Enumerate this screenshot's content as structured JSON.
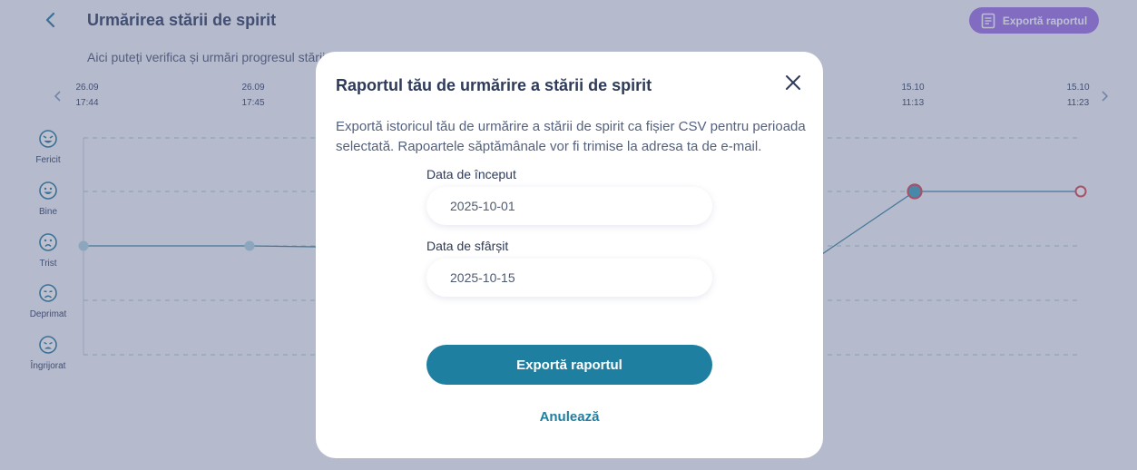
{
  "header": {
    "title": "Urmărirea stării de spirit",
    "subtitle": "Aici puteți verifica și urmări progresul stării de spirit",
    "export_label": "Exportă raportul"
  },
  "timeline": {
    "labels": [
      {
        "date": "26.09",
        "time": "17:44"
      },
      {
        "date": "26.09",
        "time": "17:45"
      },
      {
        "date": "15.10",
        "time": "11:13"
      },
      {
        "date": "15.10",
        "time": "11:23"
      }
    ]
  },
  "moods": [
    {
      "label": "Fericit",
      "icon": "happy-face-icon"
    },
    {
      "label": "Bine",
      "icon": "smile-face-icon"
    },
    {
      "label": "Trist",
      "icon": "sad-face-icon"
    },
    {
      "label": "Deprimat",
      "icon": "depressed-face-icon"
    },
    {
      "label": "Îngrijorat",
      "icon": "worried-face-icon"
    }
  ],
  "colors": {
    "accent": "#1f7fa0",
    "purple": "#a178e8",
    "line": "#3d8aa6",
    "point_highlight": "#d94f5c"
  },
  "modal": {
    "title": "Raportul tău de urmărire a stării de spirit",
    "description": "Exportă istoricul tău de urmărire a stării de spirit ca fișier CSV pentru perioada selectată. Rapoartele săptămânale vor fi trimise la adresa ta de e-mail.",
    "start_label": "Data de început",
    "start_value": "2025-10-01",
    "end_label": "Data de sfârșit",
    "end_value": "2025-10-15",
    "export_button": "Exportă raportul",
    "cancel_button": "Anulează"
  }
}
